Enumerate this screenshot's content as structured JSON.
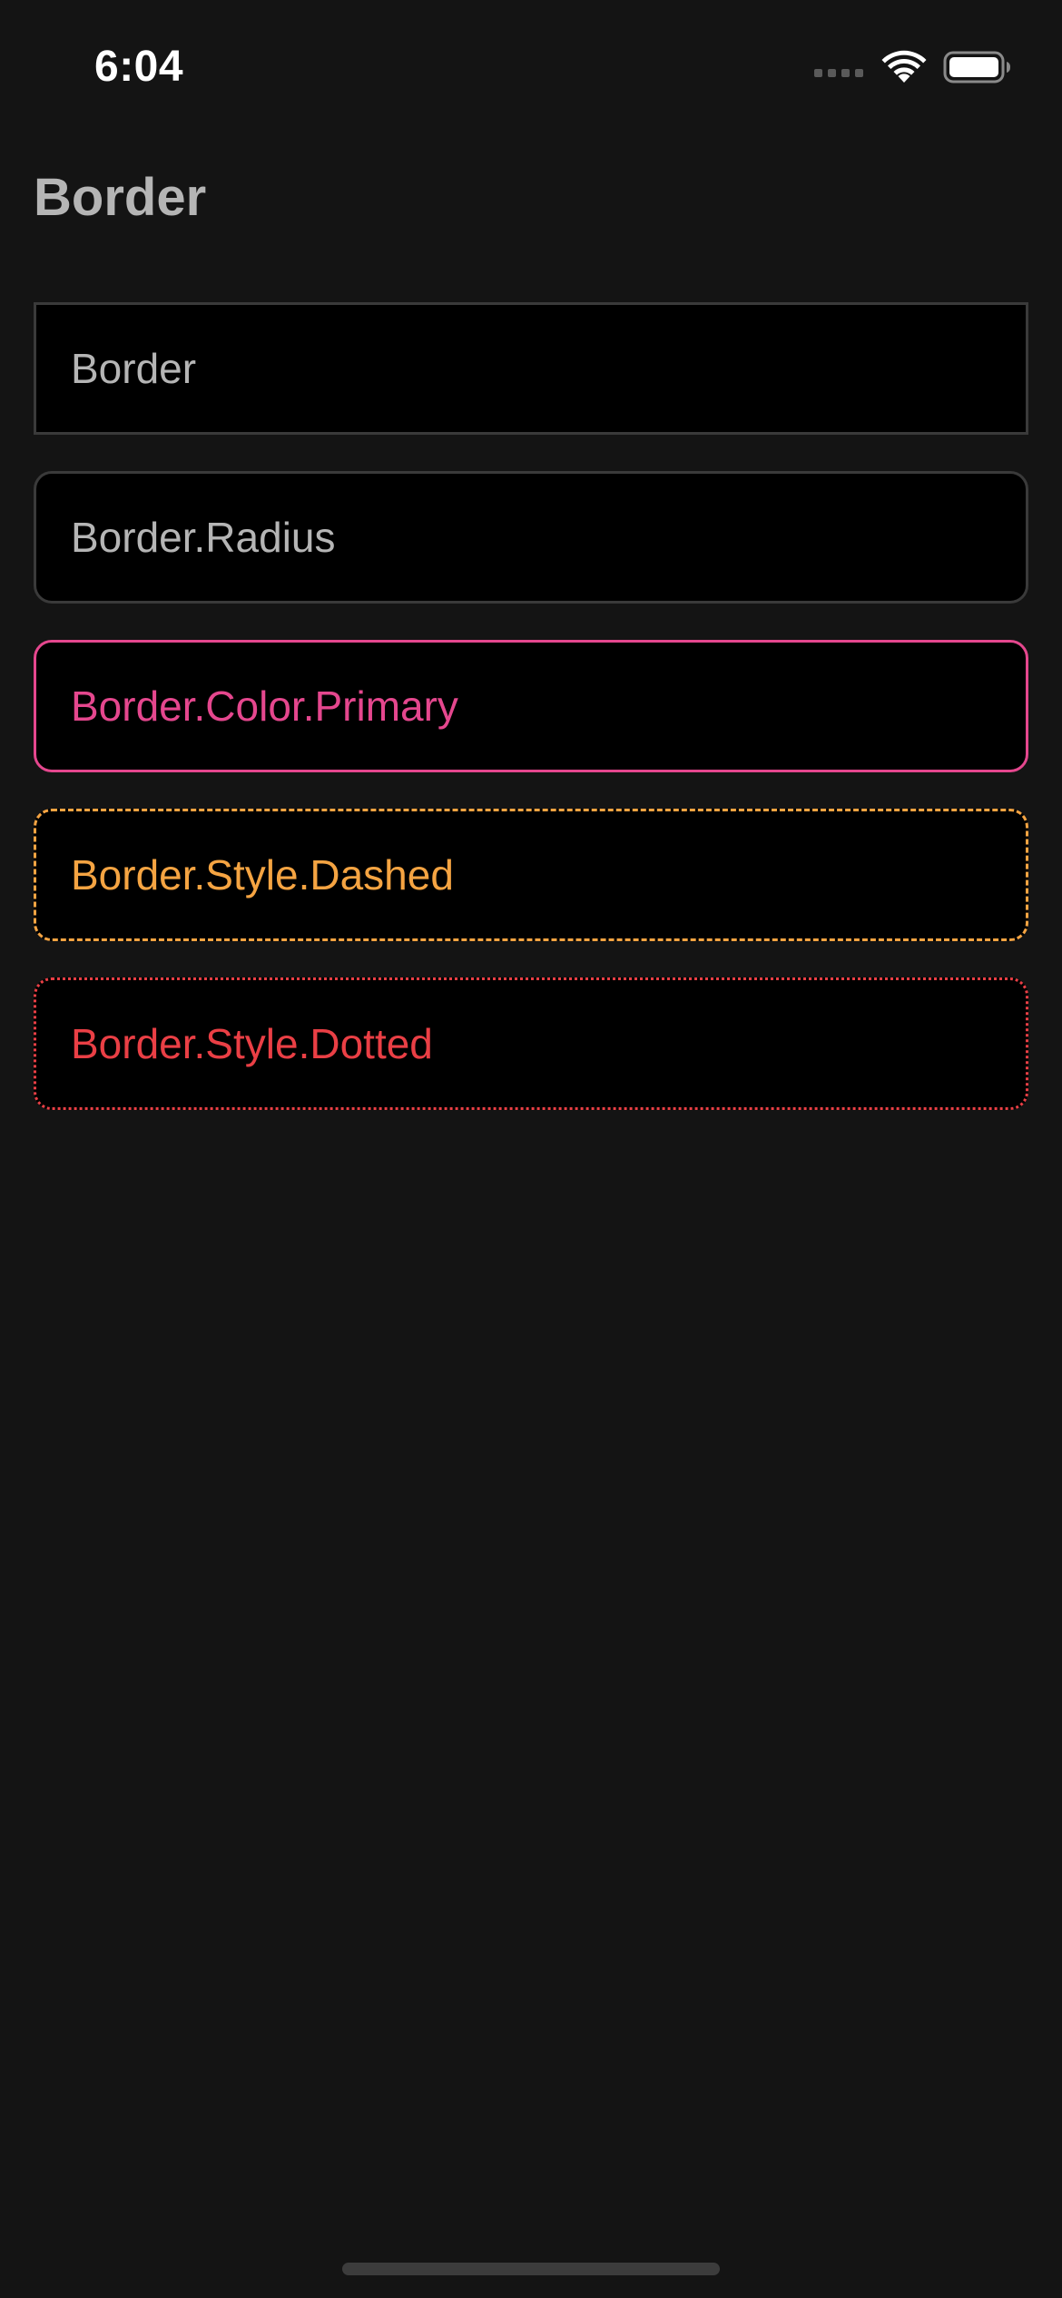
{
  "status_bar": {
    "time": "6:04",
    "signal_icon": "cellular-signal-icon",
    "wifi_icon": "wifi-icon",
    "battery_icon": "battery-icon",
    "battery_level": 1.0
  },
  "header": {
    "title": "Border"
  },
  "cards": [
    {
      "label": "Border",
      "color": "#b5b5b5",
      "border_color": "#3a3a3a"
    },
    {
      "label": "Border.Radius",
      "color": "#b5b5b5",
      "border_color": "#3a3a3a"
    },
    {
      "label": "Border.Color.Primary",
      "color": "#e5478e",
      "border_color": "#e5478e"
    },
    {
      "label": "Border.Style.Dashed",
      "color": "#f5a442",
      "border_color": "#f5a442"
    },
    {
      "label": "Border.Style.Dotted",
      "color": "#ea3f45",
      "border_color": "#ea3f45"
    }
  ],
  "colors": {
    "background": "#141414",
    "card_background": "#000000",
    "primary": "#e5478e",
    "warning": "#f5a442",
    "danger": "#ea3f45"
  }
}
